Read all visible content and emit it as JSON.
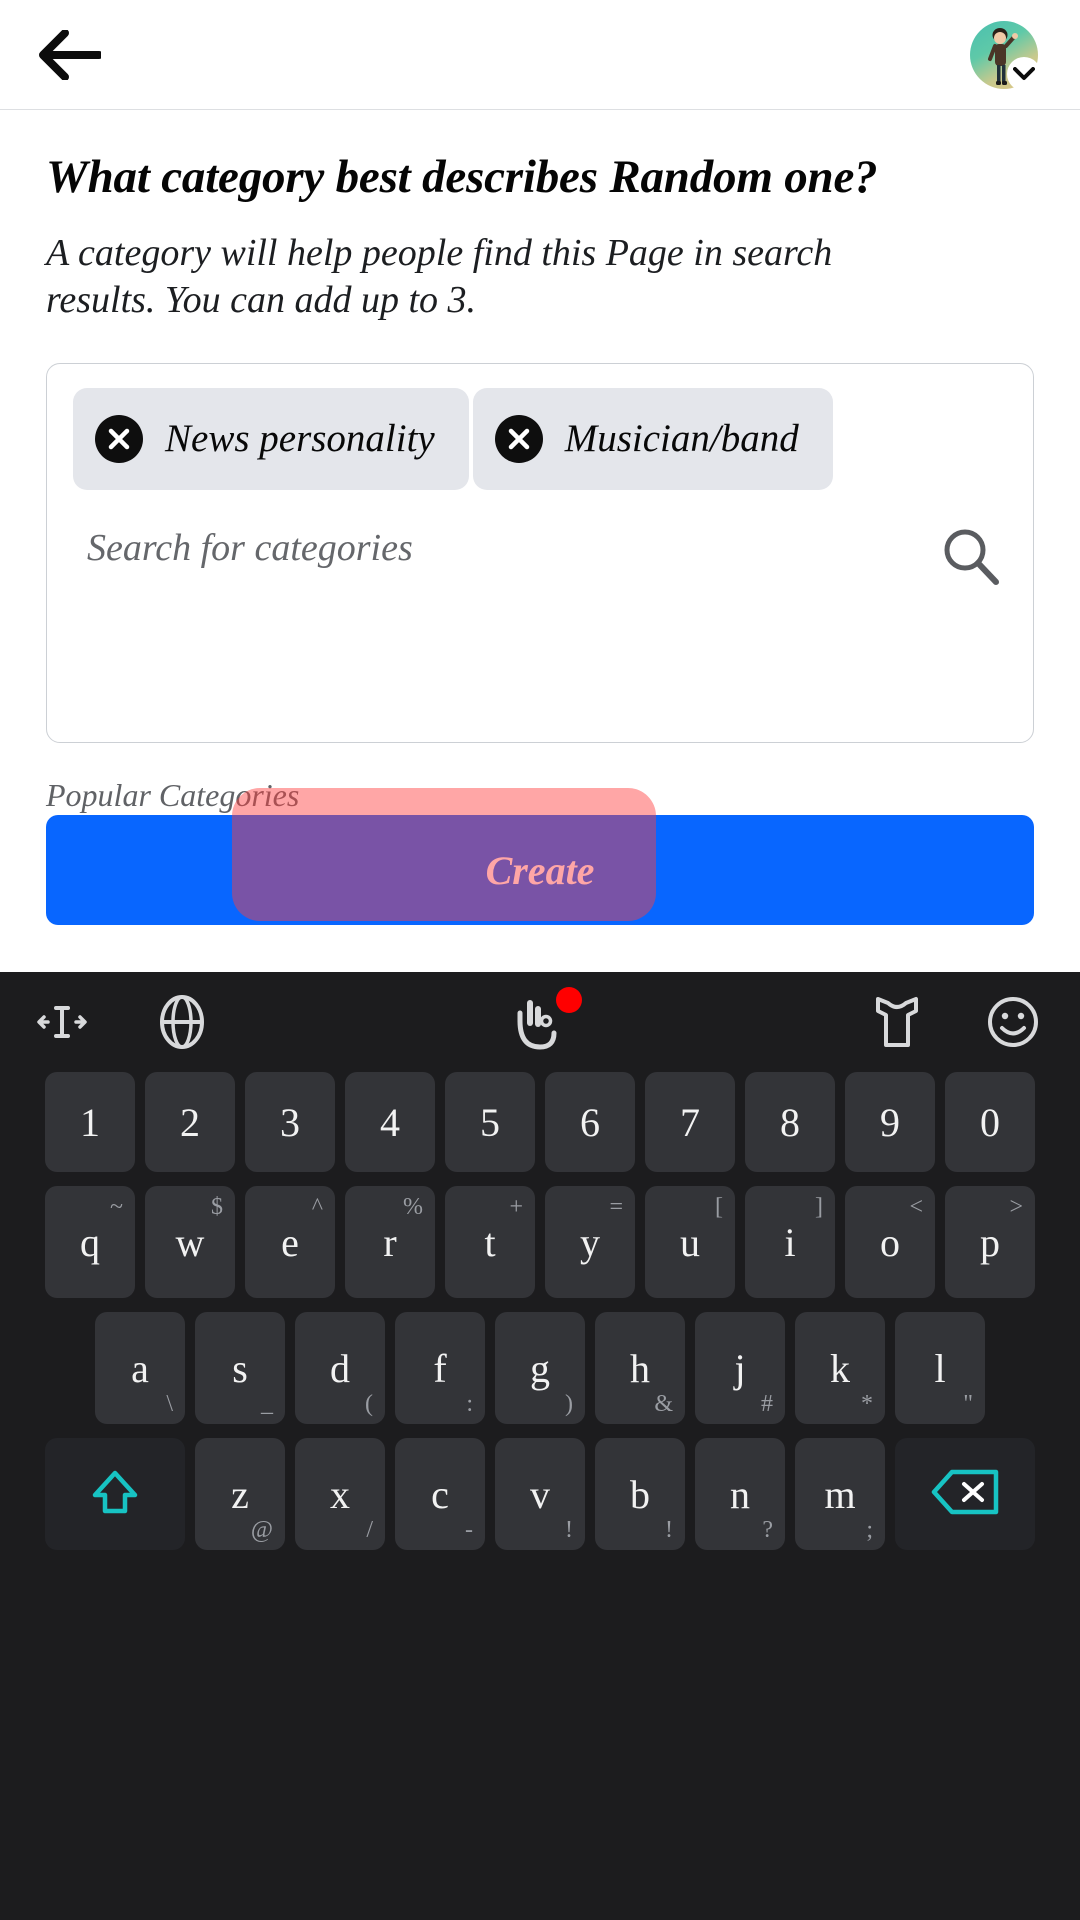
{
  "header": {
    "back_icon": "arrow-left-icon",
    "avatar_alt": "user-avatar",
    "avatar_chevron_icon": "chevron-down-icon"
  },
  "main": {
    "title": "What category best describes Random one?",
    "subtitle": "A category will help people find this Page in search results. You can add up to 3.",
    "selected_categories": [
      {
        "label": "News personality",
        "remove_icon": "close-circle-icon"
      },
      {
        "label": "Musician/band",
        "remove_icon": "close-circle-icon"
      }
    ],
    "search_placeholder": "Search for categories",
    "search_icon": "search-icon",
    "popular_label": "Popular Categories",
    "create_label": "Create",
    "create_color": "#0866ff",
    "tap_highlight_color": "#ff3c3c"
  },
  "keyboard": {
    "toolbar": [
      {
        "name": "cursor-move-icon",
        "badge": false
      },
      {
        "name": "globe-language-icon",
        "badge": false
      },
      {
        "name": "hand-gesture-icon",
        "badge": true
      },
      {
        "name": "theme-shirt-icon",
        "badge": false
      },
      {
        "name": "emoji-icon",
        "badge": false
      }
    ],
    "rows": [
      {
        "keys": [
          {
            "main": "1"
          },
          {
            "main": "2"
          },
          {
            "main": "3"
          },
          {
            "main": "4"
          },
          {
            "main": "5"
          },
          {
            "main": "6"
          },
          {
            "main": "7"
          },
          {
            "main": "8"
          },
          {
            "main": "9"
          },
          {
            "main": "0"
          }
        ]
      },
      {
        "keys": [
          {
            "main": "q",
            "sub": "~"
          },
          {
            "main": "w",
            "sub": "$"
          },
          {
            "main": "e",
            "sub": "^"
          },
          {
            "main": "r",
            "sub": "%"
          },
          {
            "main": "t",
            "sub": "+"
          },
          {
            "main": "y",
            "sub": "="
          },
          {
            "main": "u",
            "sub": "["
          },
          {
            "main": "i",
            "sub": "]"
          },
          {
            "main": "o",
            "sub": "<"
          },
          {
            "main": "p",
            "sub": ">"
          }
        ]
      },
      {
        "keys": [
          {
            "main": "a",
            "sub2": "\\"
          },
          {
            "main": "s",
            "sub2": "_"
          },
          {
            "main": "d",
            "sub2": "("
          },
          {
            "main": "f",
            "sub2": ":"
          },
          {
            "main": "g",
            "sub2": ")"
          },
          {
            "main": "h",
            "sub2": "&"
          },
          {
            "main": "j",
            "sub2": "#"
          },
          {
            "main": "k",
            "sub2": "*"
          },
          {
            "main": "l",
            "sub2": "\""
          }
        ]
      },
      {
        "keys": [
          {
            "main": "",
            "icon": "shift-icon"
          },
          {
            "main": "z",
            "sub2": "@"
          },
          {
            "main": "x",
            "sub2": "/"
          },
          {
            "main": "c",
            "sub2": "-"
          },
          {
            "main": "v",
            "sub2": "!"
          },
          {
            "main": "b",
            "sub2": "!"
          },
          {
            "main": "n",
            "sub2": "?"
          },
          {
            "main": "m",
            "sub2": ";"
          },
          {
            "main": "",
            "icon": "backspace-icon"
          }
        ]
      }
    ]
  }
}
